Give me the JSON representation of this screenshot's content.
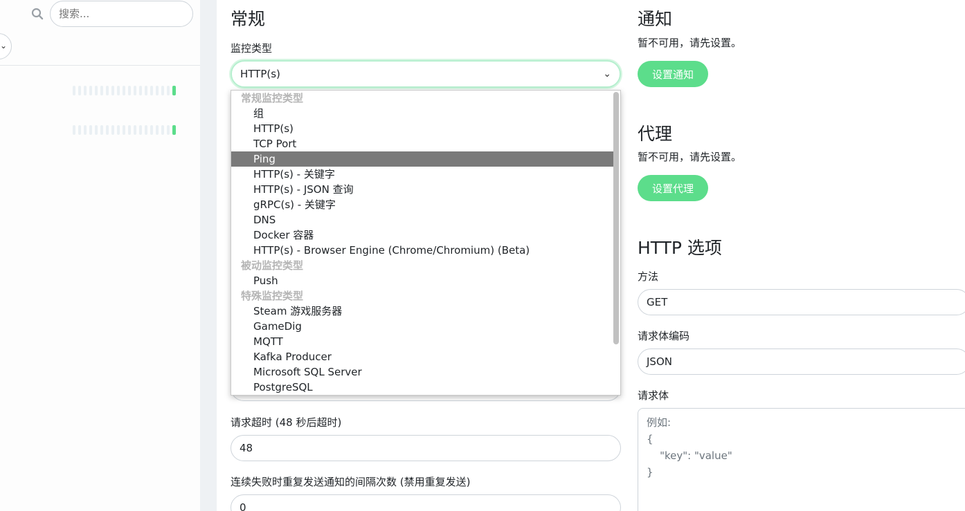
{
  "sidebar": {
    "search_placeholder": "搜索..."
  },
  "general": {
    "title": "常规",
    "monitor_type_label": "监控类型",
    "monitor_type_value": "HTTP(s)",
    "timeout_label": "请求超时 (48 秒后超时)",
    "timeout_value": "48",
    "resend_label": "连续失败时重复发送通知的间隔次数 (禁用重复发送)",
    "resend_value": "0"
  },
  "dropdown": {
    "groups": [
      {
        "label": "常规监控类型",
        "options": [
          "组",
          "HTTP(s)",
          "TCP Port",
          "Ping",
          "HTTP(s) - 关键字",
          "HTTP(s) - JSON 查询",
          "gRPC(s) - 关键字",
          "DNS",
          "Docker 容器",
          "HTTP(s) - Browser Engine (Chrome/Chromium) (Beta)"
        ]
      },
      {
        "label": "被动监控类型",
        "options": [
          "Push"
        ]
      },
      {
        "label": "特殊监控类型",
        "options": [
          "Steam 游戏服务器",
          "GameDig",
          "MQTT",
          "Kafka Producer",
          "Microsoft SQL Server",
          "PostgreSQL"
        ]
      }
    ],
    "highlighted": "Ping"
  },
  "notifications": {
    "title": "通知",
    "unavailable": "暂不可用，请先设置。",
    "button": "设置通知"
  },
  "proxy": {
    "title": "代理",
    "unavailable": "暂不可用，请先设置。",
    "button": "设置代理"
  },
  "http_options": {
    "title": "HTTP 选项",
    "method_label": "方法",
    "method_value": "GET",
    "encoding_label": "请求体编码",
    "encoding_value": "JSON",
    "body_label": "请求体",
    "body_placeholder": "例如:\n{\n    \"key\": \"value\"\n}"
  },
  "colors": {
    "accent": "#5cdd8b",
    "highlight": "#7a7a7a"
  }
}
